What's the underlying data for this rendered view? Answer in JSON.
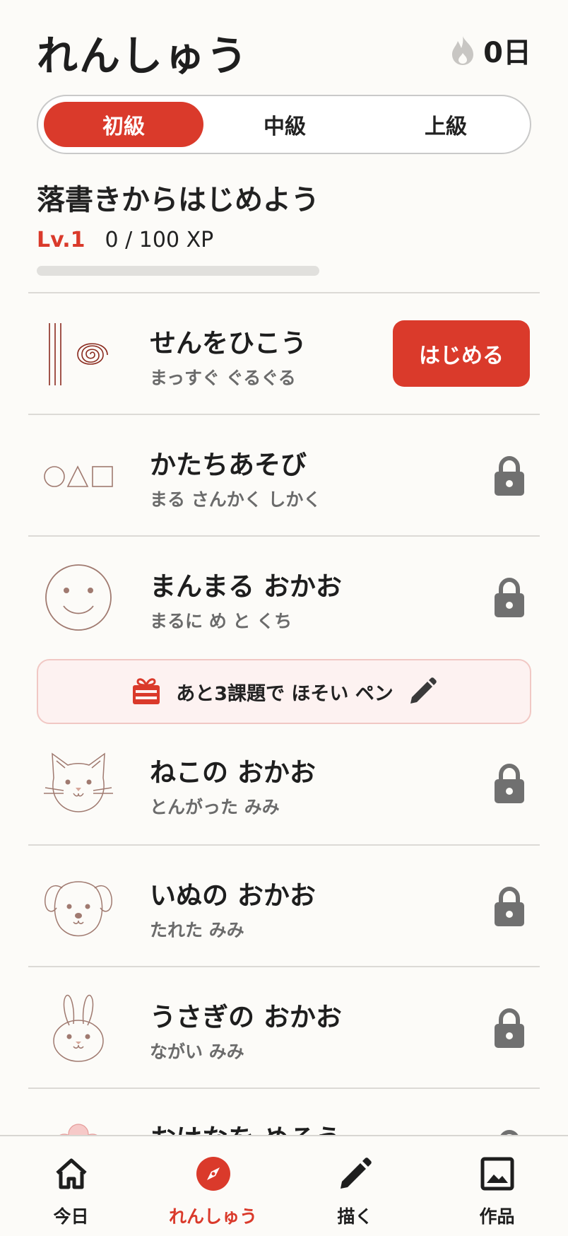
{
  "header": {
    "title": "れんしゅう",
    "streak": "0日",
    "streak_icon": "flame-icon"
  },
  "tabs": [
    {
      "label": "初級",
      "active": true
    },
    {
      "label": "中級",
      "active": false
    },
    {
      "label": "上級",
      "active": false
    }
  ],
  "section": {
    "title": "落書きからはじめよう",
    "level": "Lv.1",
    "xp_text": "0 / 100 XP",
    "xp_progress": 0.0
  },
  "lessons": [
    {
      "name": "せんをひこう",
      "sub": "まっすぐ ぐるぐる",
      "icon": "lines-spiral-icon",
      "state": "available",
      "action": "はじめる"
    },
    {
      "name": "かたちあそび",
      "sub": "まる さんかく しかく",
      "icon": "shapes-icon",
      "state": "locked"
    },
    {
      "name": "まんまる おかお",
      "sub": "まるに め と くち",
      "icon": "smiley-face-icon",
      "state": "locked"
    },
    {
      "name": "ねこの おかお",
      "sub": "とんがった みみ",
      "icon": "cat-face-icon",
      "state": "locked"
    },
    {
      "name": "いぬの おかお",
      "sub": "たれた みみ",
      "icon": "dog-face-icon",
      "state": "locked"
    },
    {
      "name": "うさぎの おかお",
      "sub": "ながい みみ",
      "icon": "rabbit-face-icon",
      "state": "locked"
    },
    {
      "name": "おはなを めろう",
      "sub": "",
      "icon": "flower-icon",
      "state": "locked"
    }
  ],
  "reward": {
    "text": "あと3課題で ほそい ペン",
    "gift_icon": "gift-icon",
    "pen_icon": "pencil-icon"
  },
  "nav": [
    {
      "label": "今日",
      "icon": "home-icon",
      "active": false
    },
    {
      "label": "れんしゅう",
      "icon": "compass-icon",
      "active": true
    },
    {
      "label": "描く",
      "icon": "pencil-icon",
      "active": false
    },
    {
      "label": "作品",
      "icon": "gallery-icon",
      "active": false
    }
  ],
  "colors": {
    "accent": "#da3a2b",
    "background": "#fcfbf8",
    "lock": "#707070",
    "thumb_stroke": "#8a4b3e"
  }
}
